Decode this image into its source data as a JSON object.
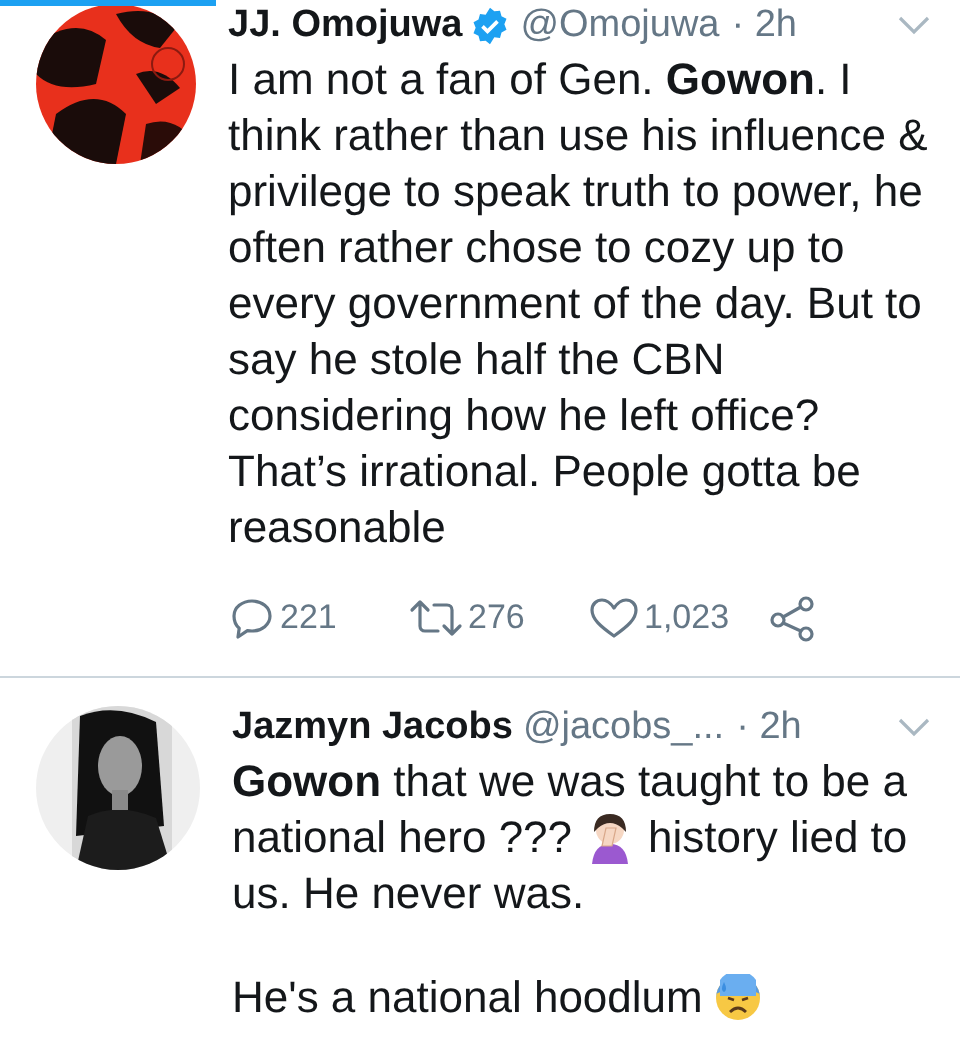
{
  "tweets": [
    {
      "name": "JJ. Omojuwa",
      "verified": true,
      "handle": "@Omojuwa",
      "time": "· 2h",
      "body": [
        [
          [
            {
              "kind": "text",
              "text": "I am not a fan of Gen. **Gowon**. I think rather than use his influence & privilege to speak truth to power, he often rather chose to cozy up to every government of the day. But to say he stole half the CBN considering how he left office? That’s irrational. People gotta be reasonable"
            }
          ]
        ]
      ],
      "actions": [
        {
          "kind": "reply",
          "count": "221"
        },
        {
          "kind": "retweet",
          "count": "276"
        },
        {
          "kind": "like",
          "count": "1,023"
        },
        {
          "kind": "share"
        }
      ]
    },
    {
      "name": "Jazmyn Jacobs",
      "verified": false,
      "handle": "@jacobs_...",
      "time": "· 2h",
      "body": [
        [
          [
            {
              "kind": "text",
              "text": "**Gowon** that we was taught to be a"
            }
          ],
          [
            {
              "kind": "text",
              "text": "national hero ???"
            },
            {
              "kind": "facepalm"
            },
            {
              "kind": "text",
              "text": "history lied to"
            }
          ],
          [
            {
              "kind": "text",
              "text": "us. He never was."
            }
          ]
        ],
        [
          [
            {
              "kind": "text",
              "text": "He's a national hoodlum"
            },
            {
              "kind": "sweat"
            }
          ]
        ]
      ]
    }
  ]
}
